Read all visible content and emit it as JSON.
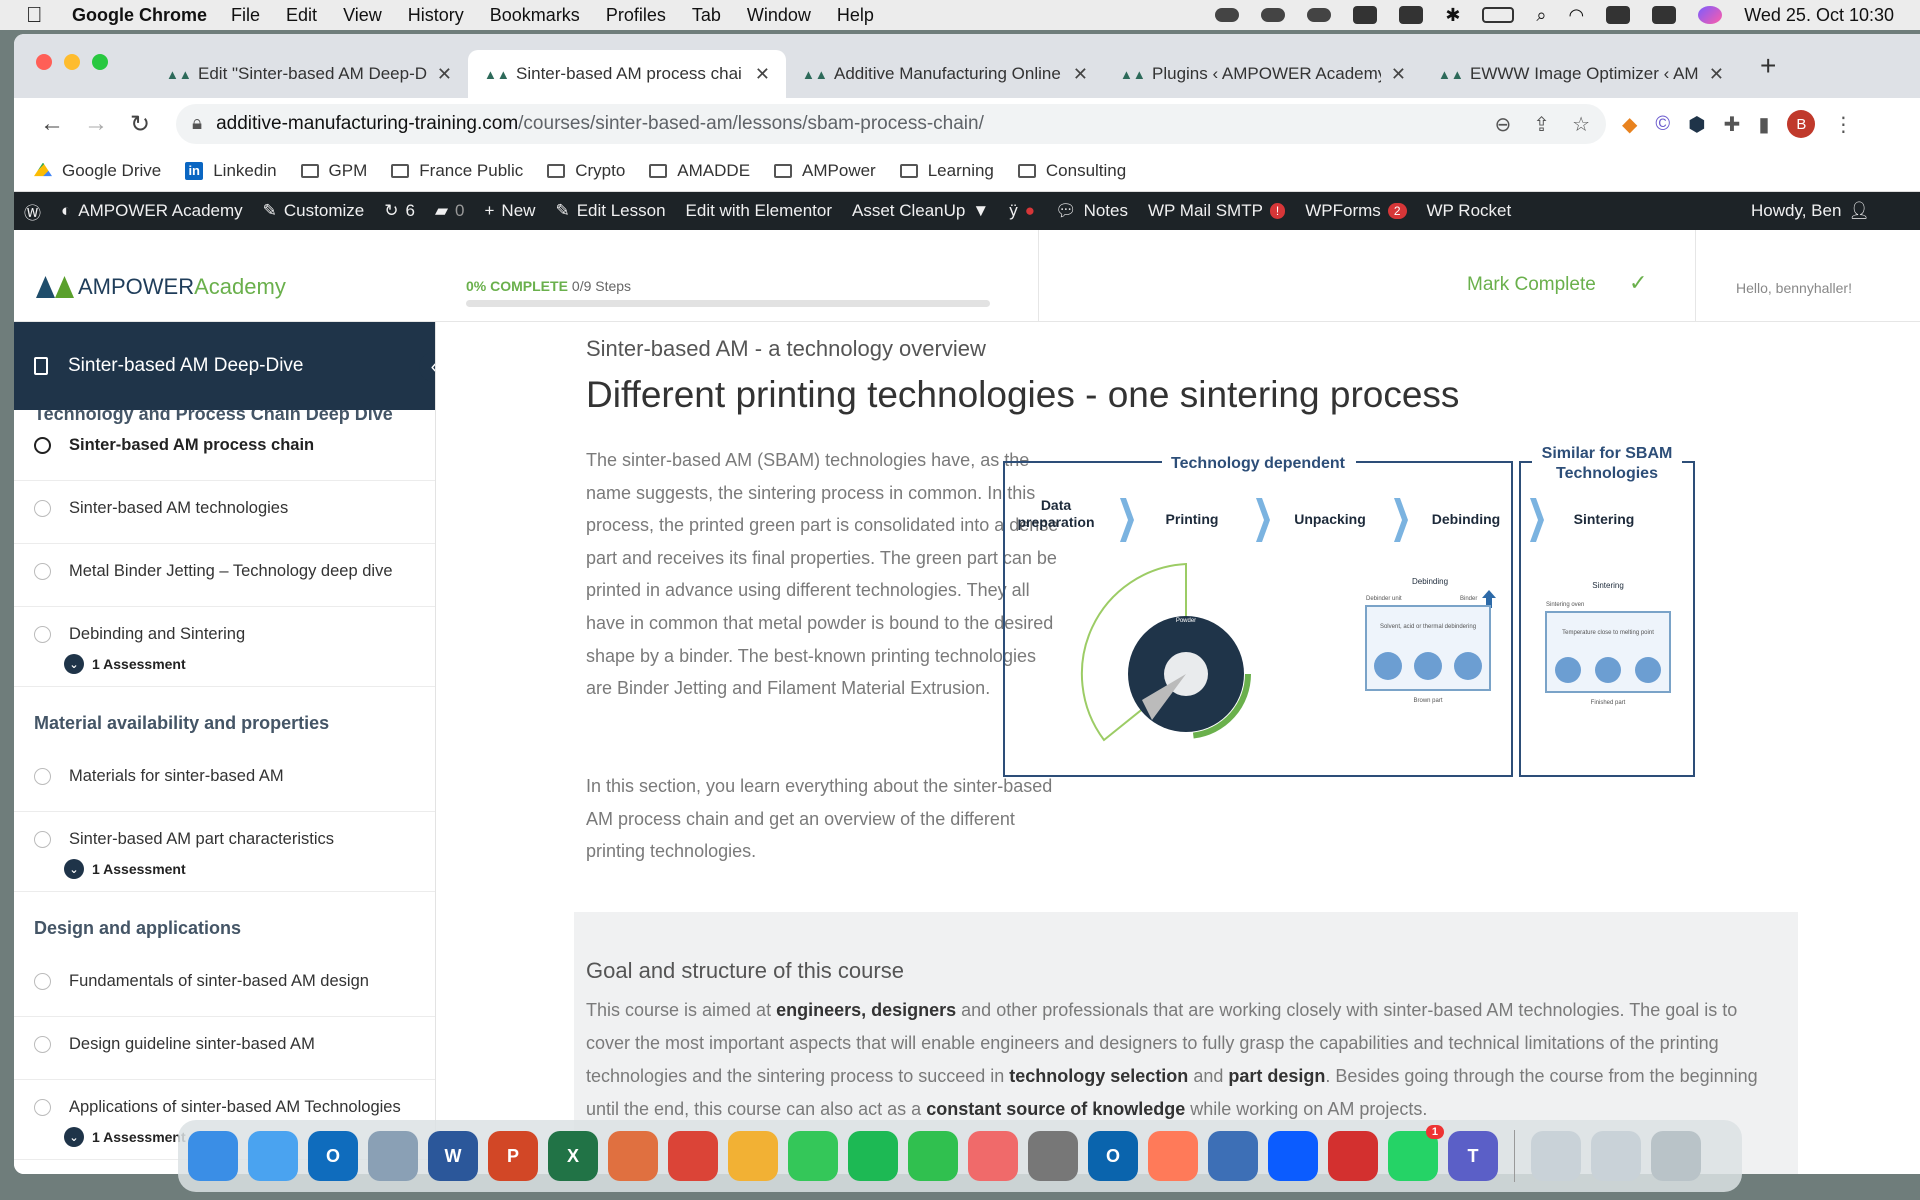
{
  "menubar": {
    "app": "Google Chrome",
    "items": [
      "File",
      "Edit",
      "View",
      "History",
      "Bookmarks",
      "Profiles",
      "Tab",
      "Window",
      "Help"
    ],
    "datetime": "Wed 25. Oct  10:30"
  },
  "tabs": [
    {
      "title": "Edit \"Sinter-based AM Deep-D",
      "active": false
    },
    {
      "title": "Sinter-based AM process chai",
      "active": true
    },
    {
      "title": "Additive Manufacturing Online",
      "active": false
    },
    {
      "title": "Plugins ‹ AMPOWER Academy",
      "active": false
    },
    {
      "title": "EWWW Image Optimizer ‹ AM",
      "active": false
    }
  ],
  "address": {
    "host": "additive-manufacturing-training.com",
    "path": "/courses/sinter-based-am/lessons/sbam-process-chain/"
  },
  "profile_initial": "B",
  "bookmarks": [
    {
      "label": "Google Drive",
      "icon": "google-drive-icon"
    },
    {
      "label": "Linkedin",
      "icon": "linkedin-icon"
    },
    {
      "label": "GPM",
      "icon": "folder-icon"
    },
    {
      "label": "France Public",
      "icon": "folder-icon"
    },
    {
      "label": "Crypto",
      "icon": "folder-icon"
    },
    {
      "label": "AMADDE",
      "icon": "folder-icon"
    },
    {
      "label": "AMPower",
      "icon": "folder-icon"
    },
    {
      "label": "Learning",
      "icon": "folder-icon"
    },
    {
      "label": "Consulting",
      "icon": "folder-icon"
    }
  ],
  "wpbar": {
    "site": "AMPOWER Academy",
    "customize": "Customize",
    "updates": "6",
    "comments": "0",
    "new": "New",
    "edit_lesson": "Edit Lesson",
    "elementor": "Edit with Elementor",
    "asset": "Asset CleanUp",
    "notes": "Notes",
    "smtp": "WP Mail SMTP",
    "smtp_badge": "!",
    "wpforms": "WPForms",
    "wpforms_badge": "2",
    "rocket": "WP Rocket",
    "howdy": "Howdy, Ben"
  },
  "header": {
    "logo_a": "AMPOWER",
    "logo_b": "Academy",
    "progress_pct": "0% COMPLETE",
    "progress_steps": "0/9 Steps",
    "progress_value": 0,
    "mark_complete": "Mark Complete",
    "hello": "Hello, bennyhaller!"
  },
  "sidebar": {
    "course": "Sinter-based AM Deep-Dive",
    "cut_section": "Technology and Process Chain Deep Dive",
    "items1": [
      {
        "label": "Sinter-based AM process chain",
        "current": true
      },
      {
        "label": "Sinter-based AM technologies"
      },
      {
        "label": "Metal Binder Jetting – Technology deep dive"
      },
      {
        "label": "Debinding and Sintering",
        "assessment": "1 Assessment"
      }
    ],
    "section2": "Material availability and properties",
    "items2": [
      {
        "label": "Materials for sinter-based AM"
      },
      {
        "label": "Sinter-based AM part characteristics",
        "assessment": "1 Assessment"
      }
    ],
    "section3": "Design and applications",
    "items3": [
      {
        "label": "Fundamentals of sinter-based AM design"
      },
      {
        "label": "Design guideline sinter-based AM"
      },
      {
        "label": "Applications of sinter-based AM Technologies",
        "assessment": "1 Assessment"
      }
    ]
  },
  "content": {
    "subtitle": "Sinter-based AM - a technology overview",
    "title": "Different printing technologies - one sintering process",
    "p1": "The sinter-based AM (SBAM) technologies have, as the name suggests, the sintering process in common. In this process, the printed green part is consolidated into a dense part and receives its final properties. The green part can be printed in advance using different technologies. They all have in common that metal powder is bound to the desired shape by a binder. The best-known printing technologies are Binder Jetting and Filament Material Extrusion.",
    "p2": "In this section, you learn everything about the sinter-based AM process chain and get an overview of the different printing technologies.",
    "figure": {
      "group1": "Technology dependent",
      "group2a": "Similar for SBAM",
      "group2b": "Technologies",
      "steps": [
        "Data preparation",
        "Printing",
        "Unpacking",
        "Debinding",
        "Sintering"
      ],
      "debind_label": "Debinding",
      "debind_unit": "Debinder unit",
      "binder": "Binder",
      "debind_text": "Solvent, acid or thermal debindering",
      "brown": "Brown part",
      "sinter_label": "Sintering",
      "sinter_oven": "Sintering oven",
      "sinter_text": "Temperature close to melting point",
      "finished": "Finished part",
      "powder": "Powder"
    },
    "goal_title": "Goal and structure of this course",
    "goal_1": "This course is aimed at ",
    "goal_b1": "engineers, designers",
    "goal_2": " and other professionals that are working closely with sinter-based AM technologies. The goal is to cover the most important aspects that will enable engineers and designers to fully grasp the capabilities and technical limitations of the printing technologies and the sintering process to succeed in ",
    "goal_b2": "technology selection",
    "goal_3": " and ",
    "goal_b3": "part design",
    "goal_4": ". Besides going through the course from the beginning until the end, this course can also act as a ",
    "goal_b4": "constant source of knowledge",
    "goal_5": " while working on AM projects."
  },
  "dock": [
    {
      "name": "finder-icon",
      "color": "#3a8ee6"
    },
    {
      "name": "mail-icon",
      "color": "#4aa3f0"
    },
    {
      "name": "outlook-icon",
      "color": "#0f6cbd",
      "text": "O"
    },
    {
      "name": "preview-icon",
      "color": "#8aa0b5"
    },
    {
      "name": "word-icon",
      "color": "#2b579a",
      "text": "W"
    },
    {
      "name": "powerpoint-icon",
      "color": "#d24726",
      "text": "P"
    },
    {
      "name": "excel-icon",
      "color": "#217346",
      "text": "X"
    },
    {
      "name": "launchpad-icon",
      "color": "#e07040"
    },
    {
      "name": "chrome-icon",
      "color": "#db4437"
    },
    {
      "name": "photos-icon",
      "color": "#f2b134"
    },
    {
      "name": "messages-icon",
      "color": "#34c759"
    },
    {
      "name": "spotify-icon",
      "color": "#1db954"
    },
    {
      "name": "facetime-icon",
      "color": "#30c04f"
    },
    {
      "name": "asana-icon",
      "color": "#f06a6a"
    },
    {
      "name": "system-settings-icon",
      "color": "#777"
    },
    {
      "name": "outlook-new-icon",
      "color": "#0a64ad",
      "text": "O"
    },
    {
      "name": "hubspot-icon",
      "color": "#ff7a59"
    },
    {
      "name": "quicktime-icon",
      "color": "#3d6fb6"
    },
    {
      "name": "zoom-icon",
      "color": "#0b5cff"
    },
    {
      "name": "acrobat-icon",
      "color": "#d3302f"
    },
    {
      "name": "whatsapp-icon",
      "color": "#25d366",
      "badge": "1"
    },
    {
      "name": "teams-icon",
      "color": "#5b5fc7",
      "text": "T"
    },
    {
      "name": "documents-stack-icon",
      "color": "#c9d2d8"
    },
    {
      "name": "downloads-stack-icon",
      "color": "#c9d2d8"
    },
    {
      "name": "trash-icon",
      "color": "#b9c3c8"
    }
  ]
}
